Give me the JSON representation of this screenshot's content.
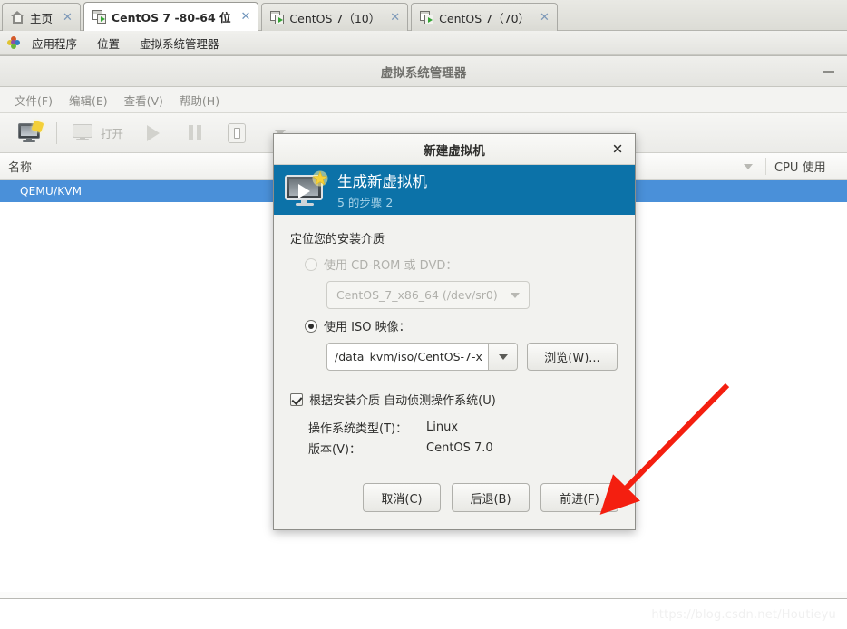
{
  "tabs": [
    {
      "label": "主页",
      "icon": "home-icon",
      "active": false,
      "close": "✕"
    },
    {
      "label": "CentOS 7 -80-64 位",
      "icon": "vm-icon",
      "active": true,
      "close": "✕"
    },
    {
      "label": "CentOS 7（10）",
      "icon": "vm-icon",
      "active": false,
      "close": "✕"
    },
    {
      "label": "CentOS 7（70）",
      "icon": "vm-icon",
      "active": false,
      "close": "✕"
    }
  ],
  "panel": {
    "icon": "applications-icon",
    "items": [
      "应用程序",
      "位置",
      "虚拟系统管理器"
    ]
  },
  "virt_manager": {
    "title": "虚拟系统管理器",
    "minimize": "minimize-icon",
    "menus": [
      "文件(F)",
      "编辑(E)",
      "查看(V)",
      "帮助(H)"
    ],
    "toolbar": {
      "new_vm_icon": "new-vm-icon",
      "open_icon": "monitor-icon",
      "open_label": "打开",
      "run_icon": "play-icon",
      "pause_icon": "pause-icon",
      "shutdown_icon": "shutdown-icon",
      "overflow_icon": "caret-down-icon"
    },
    "list": {
      "col_name": "名称",
      "col_cpu": "CPU 使用",
      "sort_icon": "caret-down-icon",
      "rows": [
        {
          "name": "QEMU/KVM",
          "selected": true
        }
      ]
    }
  },
  "dialog": {
    "title": "新建虚拟机",
    "close_icon": "close-icon",
    "banner": {
      "icon": "new-vm-large-icon",
      "heading": "生成新虚拟机",
      "step": "5 的步骤 2"
    },
    "section_label": "定位您的安装介质",
    "cdrom": {
      "radio_label": "使用  CD-ROM 或  DVD：",
      "selected": false,
      "enabled": false,
      "device": "CentOS_7_x86_64 (/dev/sr0)",
      "caret_icon": "caret-down-icon"
    },
    "iso": {
      "radio_label": "使用  ISO 映像：",
      "selected": true,
      "enabled": true,
      "path": "/data_kvm/iso/CentOS-7-x",
      "dropdown_icon": "caret-down-icon",
      "browse_label": "浏览(W)..."
    },
    "autodetect": {
      "checked": true,
      "label": "根据安装介质 自动侦测操作系统(U)"
    },
    "os_type": {
      "key": "操作系统类型(T)：",
      "value": "Linux"
    },
    "os_version": {
      "key": "版本(V)：",
      "value": "CentOS 7.0"
    },
    "buttons": {
      "cancel": "取消(C)",
      "back": "后退(B)",
      "forward": "前进(F)"
    }
  },
  "annotation": {
    "arrow": "red-arrow",
    "color": "#f41f10"
  },
  "watermark": "https://blog.csdn.net/Houtieyu",
  "colors": {
    "banner_blue": "#0c72a8",
    "selection_blue": "#4a90d9",
    "annotation_red": "#f41f10"
  }
}
